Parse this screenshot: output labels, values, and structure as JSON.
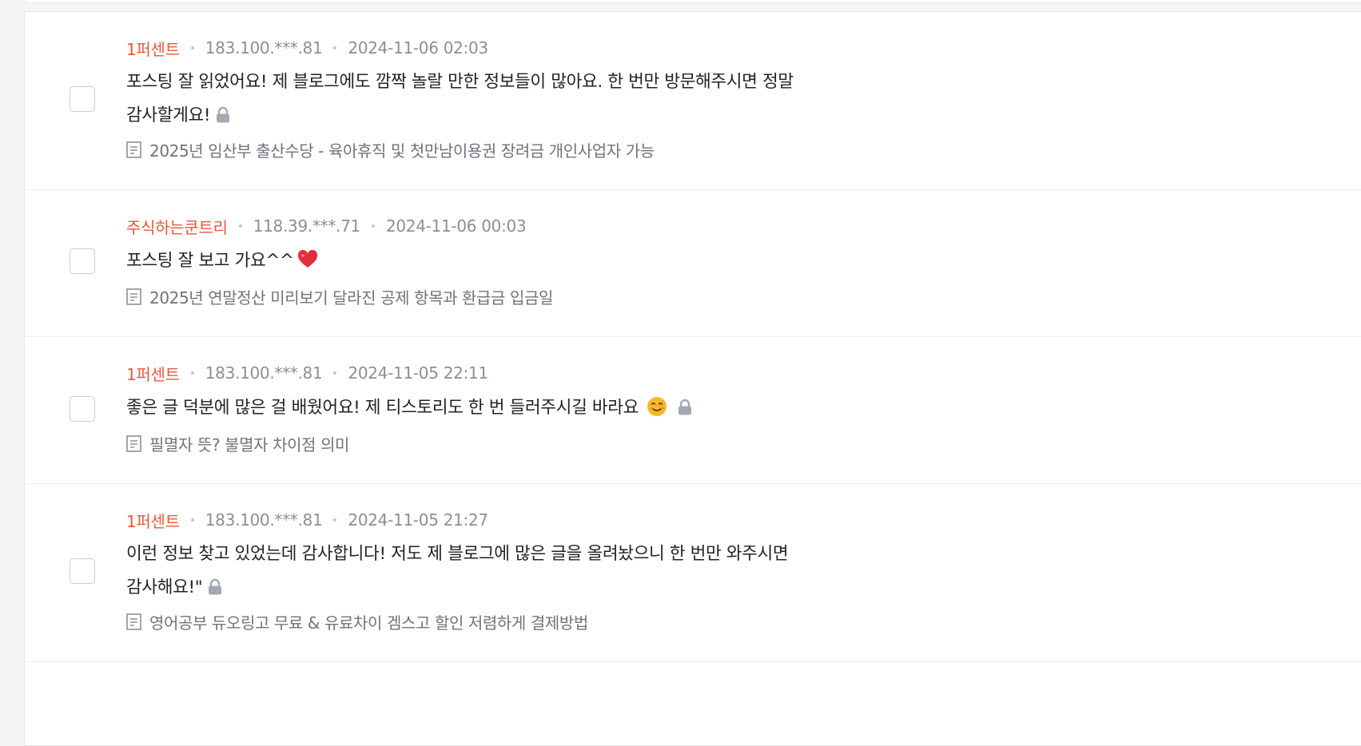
{
  "comments": [
    {
      "author": "1퍼센트",
      "ip": "183.100.***.81",
      "date": "2024-11-06 02:03",
      "text": "포스팅 잘 읽었어요! 제 블로그에도 깜짝 놀랄 만한 정보들이 많아요. 한 번만 방문해주시면 정말 감사할게요!",
      "locked": true,
      "post_title": "2025년 임산부 출산수당 - 육아휴직 및 첫만남이용권 장려금 개인사업자 가능",
      "post_icon": "document-icon"
    },
    {
      "author": "주식하는쿤트리",
      "ip": "118.39.***.71",
      "date": "2024-11-06 00:03",
      "text": "포스팅 잘 보고 가요^^",
      "emoji": "heart-emoji",
      "post_title": "2025년 연말정산 미리보기 달라진 공제 항목과 환급금 입금일",
      "post_icon": "document-icon"
    },
    {
      "author": "1퍼센트",
      "ip": "183.100.***.81",
      "date": "2024-11-05 22:11",
      "text": "좋은 글 덕분에 많은 걸 배웠어요! 제 티스토리도 한 번 들러주시길 바라요",
      "emoji": "smiling-face-emoji",
      "locked": true,
      "post_title": "필멸자 뜻? 불멸자 차이점 의미",
      "post_icon": "document-icon"
    },
    {
      "author": "1퍼센트",
      "ip": "183.100.***.81",
      "date": "2024-11-05 21:27",
      "text": "이런 정보 찾고 있었는데 감사합니다! 저도 제 블로그에 많은 글을 올려놨으니 한 번만 와주시면 감사해요!\"",
      "locked": true,
      "post_title": "영어공부 듀오링고 무료 & 유료차이 겜스고 할인 저렴하게 결제방법",
      "post_icon": "document-icon"
    }
  ],
  "colors": {
    "author": "#e8573f",
    "meta": "#8a8f97",
    "text": "#1f2226",
    "border": "#eceef1",
    "background": "#f4f5f7"
  }
}
